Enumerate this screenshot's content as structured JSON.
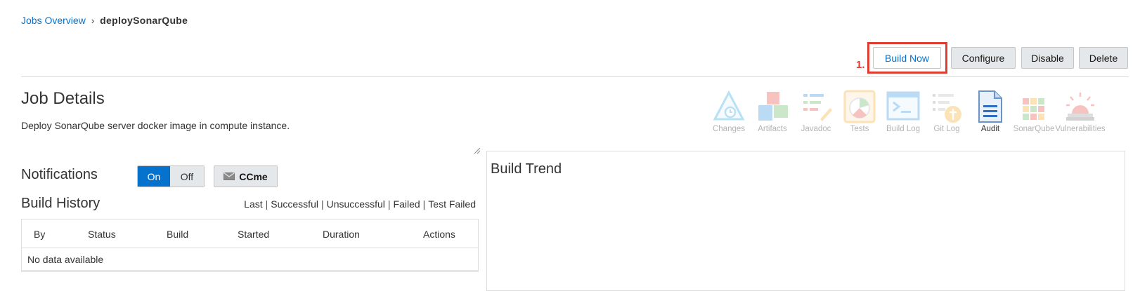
{
  "breadcrumb": {
    "link": "Jobs Overview",
    "separator": "›",
    "current": "deploySonarQube"
  },
  "annotation": {
    "number": "1."
  },
  "actions": {
    "build_now": "Build Now",
    "configure": "Configure",
    "disable": "Disable",
    "delete": "Delete"
  },
  "job": {
    "title": "Job Details",
    "description": "Deploy SonarQube server docker image in compute instance."
  },
  "tools": [
    {
      "label": "Changes",
      "icon": "changes-icon",
      "enabled": false
    },
    {
      "label": "Artifacts",
      "icon": "artifacts-icon",
      "enabled": false
    },
    {
      "label": "Javadoc",
      "icon": "javadoc-icon",
      "enabled": false
    },
    {
      "label": "Tests",
      "icon": "tests-icon",
      "enabled": false
    },
    {
      "label": "Build Log",
      "icon": "build-log-icon",
      "enabled": false
    },
    {
      "label": "Git Log",
      "icon": "git-log-icon",
      "enabled": false
    },
    {
      "label": "Audit",
      "icon": "audit-icon",
      "enabled": true
    },
    {
      "label": "SonarQube",
      "icon": "sonarqube-icon",
      "enabled": false
    },
    {
      "label": "Vulnerabilities",
      "icon": "vulnerabilities-icon",
      "enabled": false
    }
  ],
  "notifications": {
    "label": "Notifications",
    "on": "On",
    "off": "Off",
    "selected": "On",
    "ccme": "CCme"
  },
  "history": {
    "title": "Build History",
    "filters": [
      "Last",
      "Successful",
      "Unsuccessful",
      "Failed",
      "Test Failed"
    ],
    "columns": [
      "By",
      "Status",
      "Build",
      "Started",
      "Duration",
      "Actions"
    ],
    "empty": "No data available"
  },
  "trend": {
    "title": "Build Trend"
  },
  "colors": {
    "accent": "#0572ce",
    "annotation": "#e03c31",
    "button_bg": "#e4e8ea"
  }
}
